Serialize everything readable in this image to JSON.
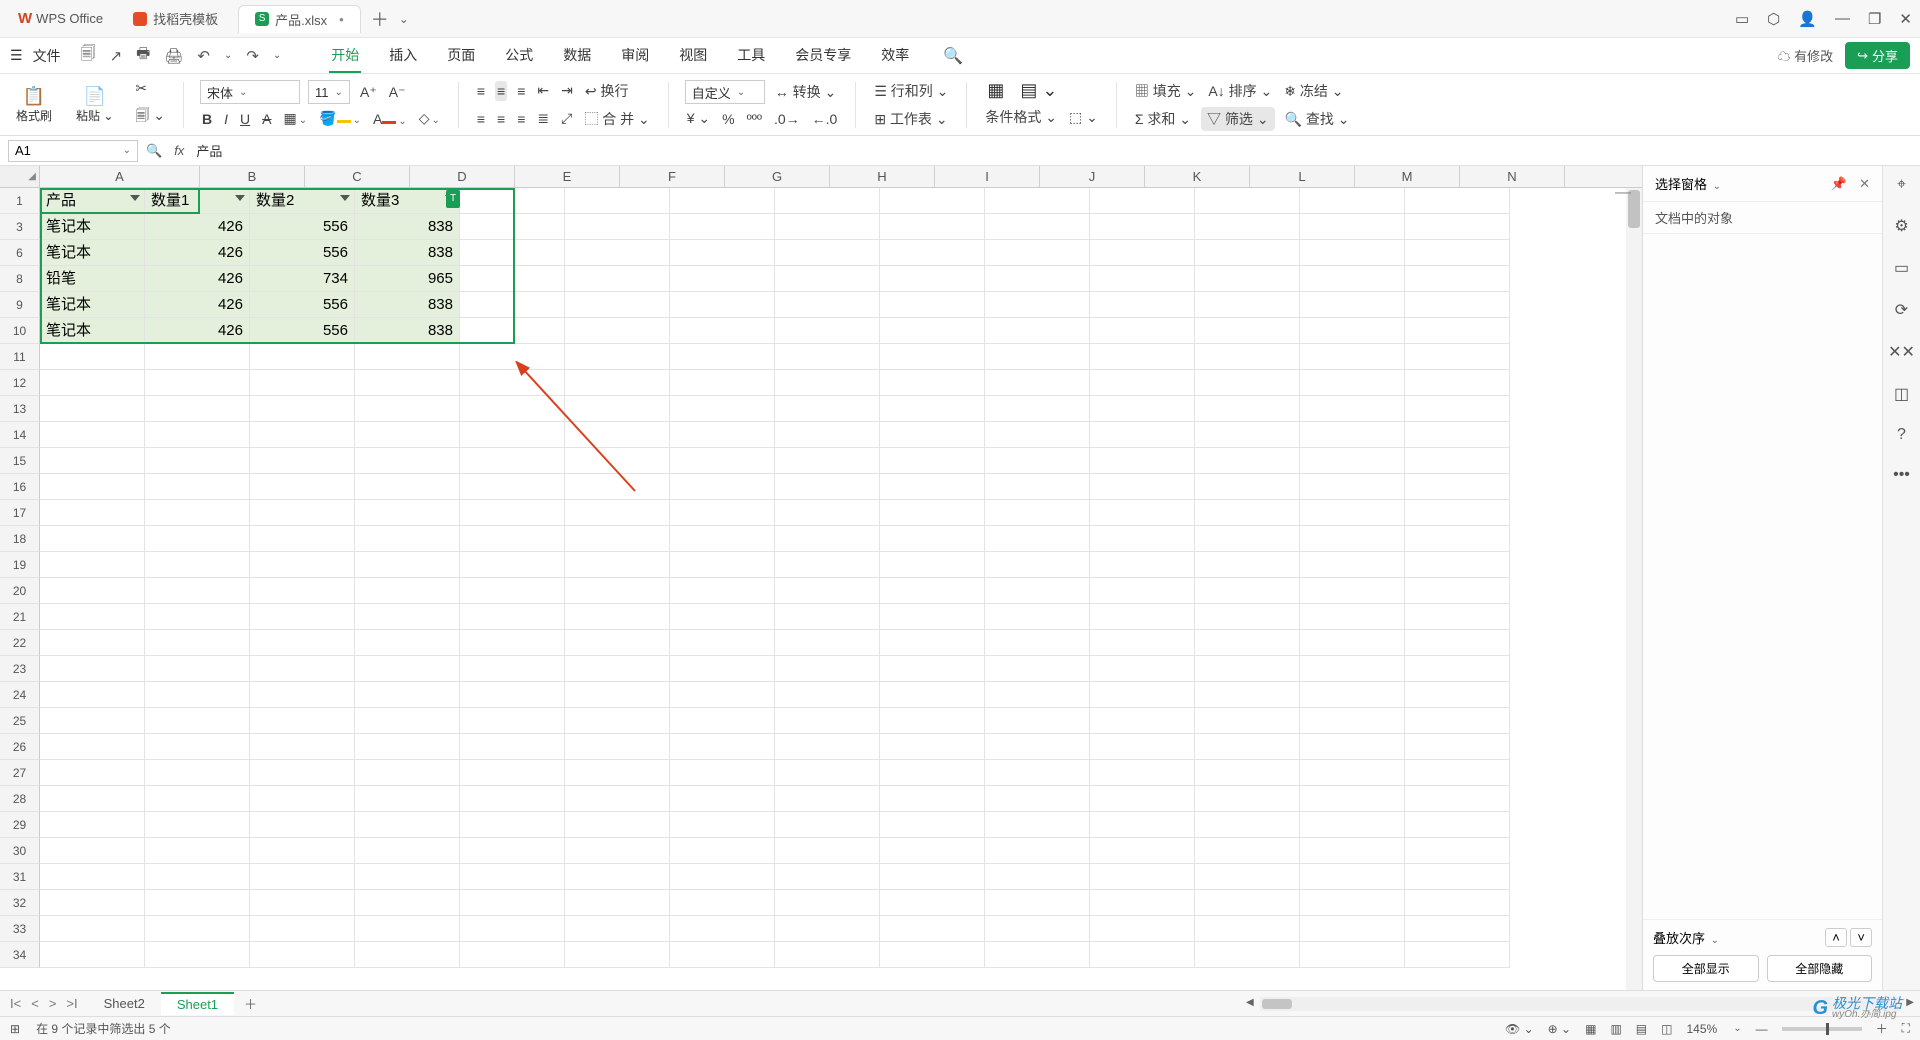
{
  "titlebar": {
    "app_name": "WPS Office",
    "tabs": [
      {
        "label": "找稻壳模板",
        "icon": "red"
      },
      {
        "label": "产品.xlsx",
        "icon": "green",
        "badge": "S",
        "modified": "•"
      }
    ],
    "win_icons": [
      "▭",
      "⬡",
      "👤",
      "—",
      "❐",
      "✕"
    ]
  },
  "menubar": {
    "file_label": "文件",
    "hamburger": "☰",
    "qat": [
      "🗐",
      "↗",
      "🖶",
      "🖨",
      "↶",
      "⌄",
      "↷",
      "⌄"
    ],
    "menus": [
      "开始",
      "插入",
      "页面",
      "公式",
      "数据",
      "审阅",
      "视图",
      "工具",
      "会员专享",
      "效率"
    ],
    "current": "开始",
    "cloud_label": "有修改",
    "share_label": "分享"
  },
  "ribbon": {
    "format_painter": "格式刷",
    "paste": "粘贴",
    "font_name": "宋体",
    "font_size": "11",
    "wrap": "换行",
    "merge": "合 并",
    "numfmt": "自定义",
    "convert": "转换",
    "rowcol": "行和列",
    "worksheet": "工作表",
    "cond": "条件格式",
    "fill": "填充",
    "sort": "排序",
    "freeze": "冻结",
    "sum": "求和",
    "filter": "筛选",
    "find": "查找"
  },
  "formula_bar": {
    "cell_ref": "A1",
    "formula": "产品"
  },
  "sheet": {
    "columns": [
      "A",
      "B",
      "C",
      "D",
      "E",
      "F",
      "G",
      "H",
      "I",
      "J",
      "K",
      "L",
      "M",
      "N"
    ],
    "visible_row_numbers": [
      1,
      3,
      6,
      8,
      9,
      10,
      11,
      12,
      13,
      14,
      15,
      16,
      17,
      18,
      19,
      20,
      21,
      22,
      23,
      24,
      25,
      26,
      27,
      28,
      29,
      30,
      31,
      32,
      33,
      34
    ],
    "headers": [
      "产品",
      "数量1",
      "数量2",
      "数量3"
    ],
    "rows": [
      {
        "a": "笔记本",
        "b": "426",
        "c": "556",
        "d": "838"
      },
      {
        "a": "笔记本",
        "b": "426",
        "c": "556",
        "d": "838"
      },
      {
        "a": "铅笔",
        "b": "426",
        "c": "734",
        "d": "965"
      },
      {
        "a": "笔记本",
        "b": "426",
        "c": "556",
        "d": "838"
      },
      {
        "a": "笔记本",
        "b": "426",
        "c": "556",
        "d": "838"
      }
    ],
    "filter_badge": "T"
  },
  "sidepanel": {
    "title": "选择窗格",
    "subtitle": "文档中的对象",
    "order_label": "叠放次序",
    "btn_show_all": "全部显示",
    "btn_hide_all": "全部隐藏"
  },
  "sheet_tabs": {
    "tabs": [
      "Sheet2",
      "Sheet1"
    ],
    "active": "Sheet1"
  },
  "statusbar": {
    "msg": "在 9 个记录中筛选出 5 个",
    "zoom": "145%"
  },
  "watermark": {
    "brand": "极光下载站",
    "sub": "wyOh.办简.ipg"
  }
}
